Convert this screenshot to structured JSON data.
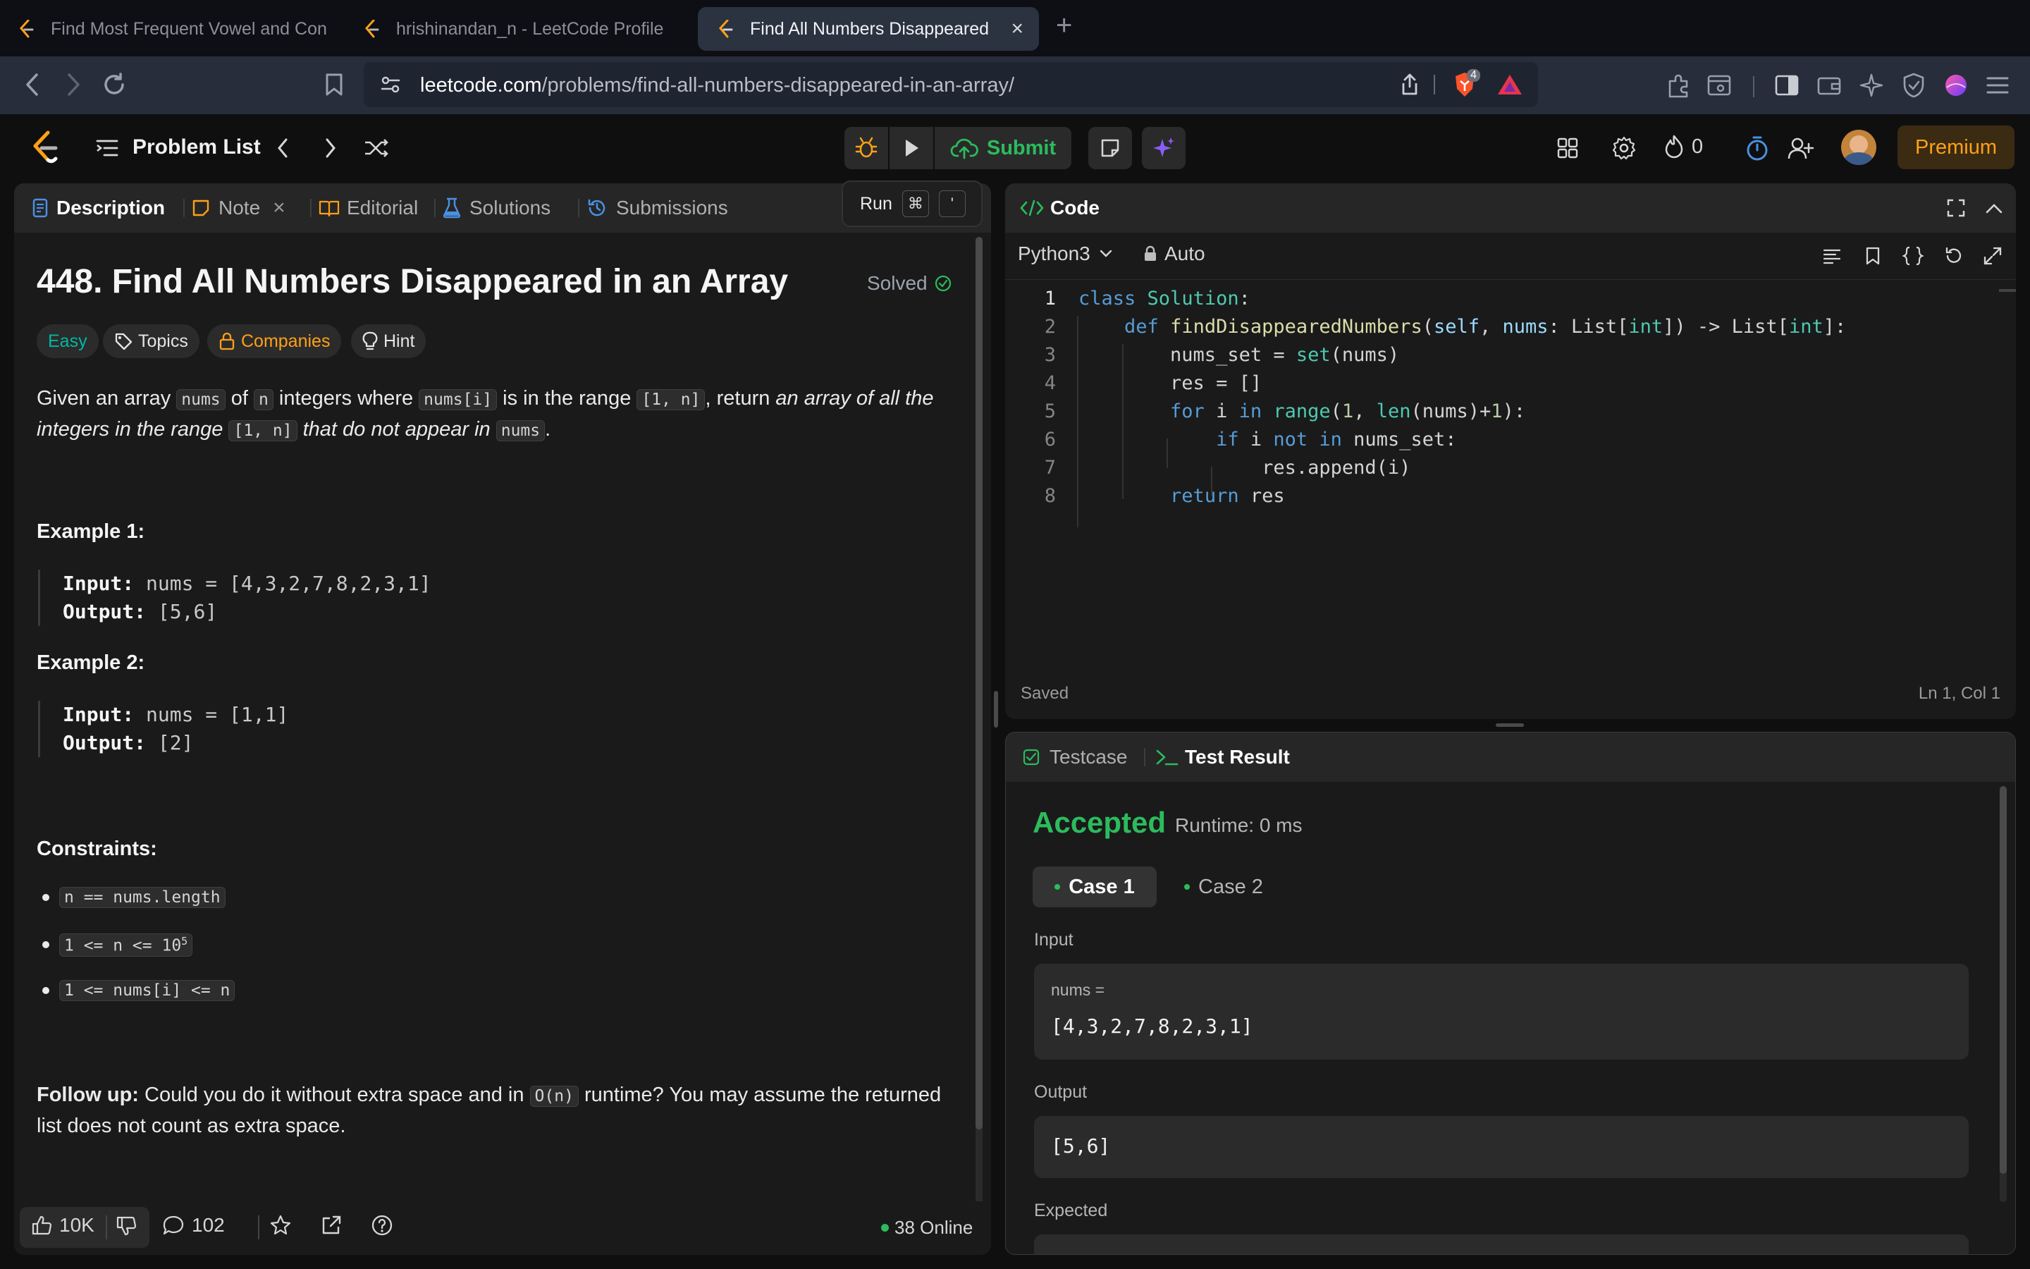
{
  "browser": {
    "tabs": [
      {
        "title": "Find Most Frequent Vowel and Con"
      },
      {
        "title": "hrishinandan_n - LeetCode Profile"
      },
      {
        "title": "Find All Numbers Disappeared"
      }
    ],
    "url_host": "leetcode.com",
    "url_path": "/problems/find-all-numbers-disappeared-in-an-array/",
    "shield_badge": "4"
  },
  "header": {
    "problem_list": "Problem List",
    "submit": "Submit",
    "streak": "0",
    "premium": "Premium",
    "run_tooltip": "Run",
    "run_key1": "⌘",
    "run_key2": "'"
  },
  "left_panel": {
    "tabs": [
      "Description",
      "Note",
      "Editorial",
      "Solutions",
      "Submissions"
    ],
    "title": "448. Find All Numbers Disappeared in an Array",
    "solved": "Solved",
    "chips": {
      "difficulty": "Easy",
      "topics": "Topics",
      "companies": "Companies",
      "hint": "Hint"
    },
    "desc": {
      "t1": "Given an array ",
      "c1": "nums",
      "t2": " of ",
      "c2": "n",
      "t3": " integers where ",
      "c3": "nums[i]",
      "t4": " is in the range ",
      "c4": "[1, n]",
      "t5": ", return ",
      "i1": "an array of all the",
      "i2": "integers in the range ",
      "c5": "[1, n]",
      "i3": " that do not appear in ",
      "c6": "nums",
      "t6": "."
    },
    "examples": [
      {
        "heading": "Example 1:",
        "input_label": "Input:",
        "input": " nums = [4,3,2,7,8,2,3,1]",
        "output_label": "Output:",
        "output": " [5,6]"
      },
      {
        "heading": "Example 2:",
        "input_label": "Input:",
        "input": " nums = [1,1]",
        "output_label": "Output:",
        "output": " [2]"
      }
    ],
    "constraints_heading": "Constraints:",
    "constraints": [
      "n == nums.length",
      "1 <= n <= 10",
      "1 <= nums[i] <= n"
    ],
    "constraint_sup": "5",
    "followup_label": "Follow up:",
    "followup_t1": " Could you do it without extra space and in ",
    "followup_code": "O(n)",
    "followup_t2": " runtime? You may assume the returned",
    "followup_t3": "list does not count as extra space.",
    "footer": {
      "likes": "10K",
      "comments": "102",
      "online": "38 Online"
    }
  },
  "code_panel": {
    "title": "Code",
    "language": "Python3",
    "mode": "Auto",
    "status": "Saved",
    "cursor": "Ln 1, Col 1",
    "line_numbers": [
      "1",
      "2",
      "3",
      "4",
      "5",
      "6",
      "7",
      "8"
    ],
    "code": {
      "l1a": "class",
      "l1b": " ",
      "l1c": "Solution",
      "l1d": ":",
      "l2a": "    ",
      "l2b": "def",
      "l2c": " ",
      "l2d": "findDisappearedNumbers",
      "l2e": "(",
      "l2f": "self",
      "l2g": ", ",
      "l2h": "nums",
      "l2i": ": List[",
      "l2j": "int",
      "l2k": "]) -> List[",
      "l2l": "int",
      "l2m": "]:",
      "l3a": "        nums_set = ",
      "l3b": "set",
      "l3c": "(nums)",
      "l4": "        res = []",
      "l5a": "        ",
      "l5b": "for",
      "l5c": " i ",
      "l5d": "in",
      "l5e": " ",
      "l5f": "range",
      "l5g": "(",
      "l5h": "1",
      "l5i": ", ",
      "l5j": "len",
      "l5k": "(nums)+",
      "l5l": "1",
      "l5m": "):",
      "l6a": "            ",
      "l6b": "if",
      "l6c": " i ",
      "l6d": "not in",
      "l6e": " nums_set:",
      "l7": "                res.append(i)",
      "l8a": "        ",
      "l8b": "return",
      "l8c": " res"
    }
  },
  "test_panel": {
    "tabs": [
      "Testcase",
      "Test Result"
    ],
    "status": "Accepted",
    "runtime": "Runtime: 0 ms",
    "cases": [
      "Case 1",
      "Case 2"
    ],
    "input_label": "Input",
    "input_var": "nums =",
    "input_value": "[4,3,2,7,8,2,3,1]",
    "output_label": "Output",
    "output_value": "[5,6]",
    "expected_label": "Expected"
  },
  "colors": {
    "accent": "#ffa116",
    "accepted": "#2cbb5d",
    "easy": "#00b8a3",
    "link_blue": "#4a90e2"
  }
}
